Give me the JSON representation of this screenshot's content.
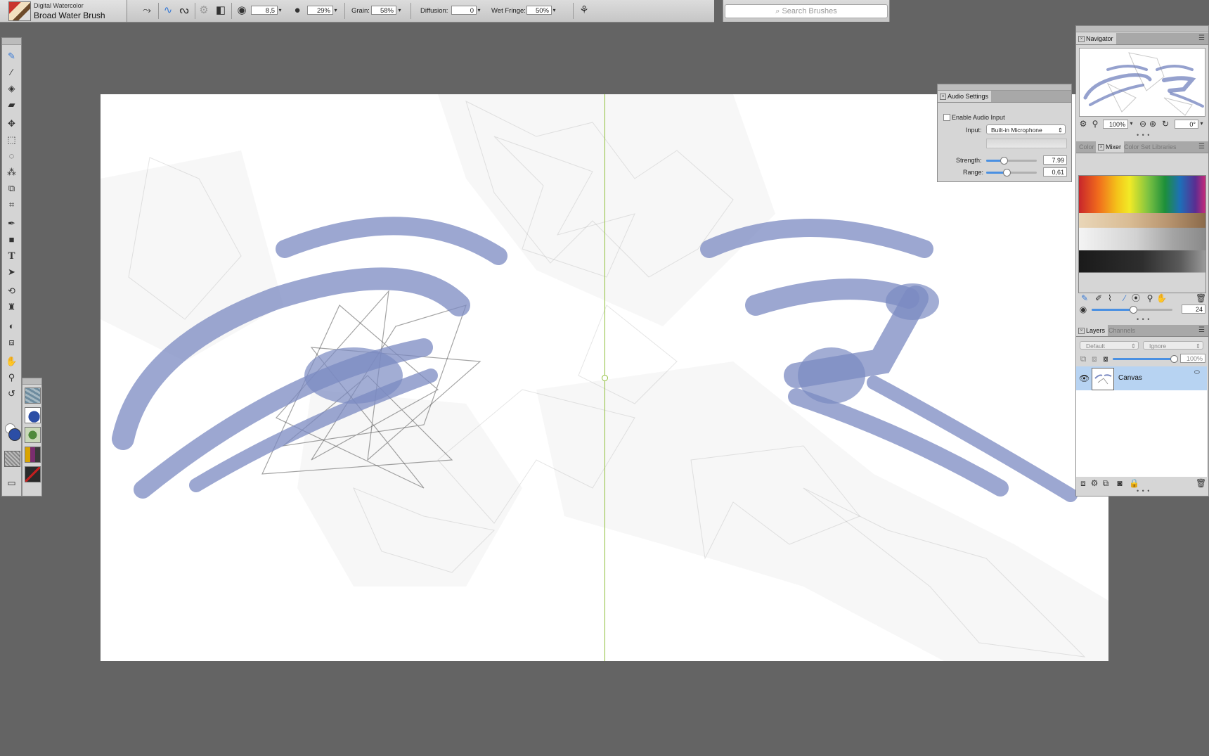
{
  "brush": {
    "category": "Digital Watercolor",
    "name": "Broad Water Brush"
  },
  "property_bar": {
    "size_value": "8,5",
    "opacity_value": "29%",
    "grain_label": "Grain:",
    "grain_value": "58%",
    "diffusion_label": "Diffusion:",
    "diffusion_value": "0",
    "wet_fringe_label": "Wet Fringe:",
    "wet_fringe_value": "50%"
  },
  "search": {
    "placeholder": "Search Brushes"
  },
  "navigator": {
    "title": "Navigator",
    "zoom": "100%",
    "rotation": "0°"
  },
  "audio_settings": {
    "title": "Audio Settings",
    "enable_label": "Enable Audio Input",
    "enabled": false,
    "input_label": "Input:",
    "input_value": "Built-in Microphone",
    "strength_label": "Strength:",
    "strength_value": "7.99",
    "range_label": "Range:",
    "range_value": "0,61"
  },
  "color_panel": {
    "tabs": [
      "Color",
      "Mixer",
      "Color Set Libraries"
    ],
    "active_tab": "Mixer",
    "brush_size": "24"
  },
  "layers_panel": {
    "tabs": [
      "Layers",
      "Channels"
    ],
    "composite_method": "Default",
    "preserve": "Ignore",
    "opacity": "100%",
    "layers": [
      {
        "name": "Canvas",
        "visible": true,
        "selected": true
      }
    ]
  },
  "colors": {
    "accent": "#4a90e2",
    "selected_layer": "#b7d3f2",
    "paint_blue": "#7b8ac2",
    "guide": "#8fbf3a",
    "workspace": "#646464"
  }
}
